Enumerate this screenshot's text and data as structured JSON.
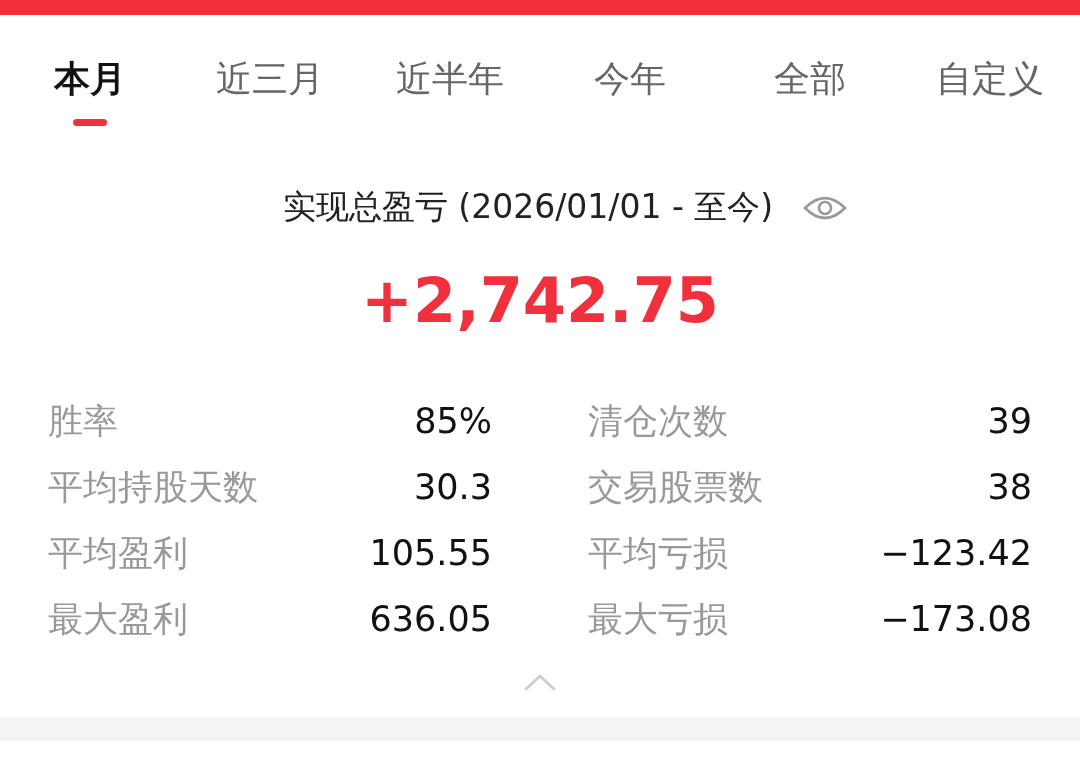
{
  "tabs": [
    {
      "label": "本月",
      "selected": true
    },
    {
      "label": "近三月",
      "selected": false
    },
    {
      "label": "近半年",
      "selected": false
    },
    {
      "label": "今年",
      "selected": false
    },
    {
      "label": "全部",
      "selected": false
    },
    {
      "label": "自定义",
      "selected": false
    }
  ],
  "summary": {
    "title": "实现总盈亏 (2026/01/01 - 至今)",
    "value": "+2,742.75"
  },
  "stats": [
    {
      "label": "胜率",
      "value": "85%"
    },
    {
      "label": "清仓次数",
      "value": "39"
    },
    {
      "label": "平均持股天数",
      "value": "30.3"
    },
    {
      "label": "交易股票数",
      "value": "38"
    },
    {
      "label": "平均盈利",
      "value": "105.55"
    },
    {
      "label": "平均亏损",
      "value": "−123.42"
    },
    {
      "label": "最大盈利",
      "value": "636.05"
    },
    {
      "label": "最大亏损",
      "value": "−173.08"
    }
  ]
}
